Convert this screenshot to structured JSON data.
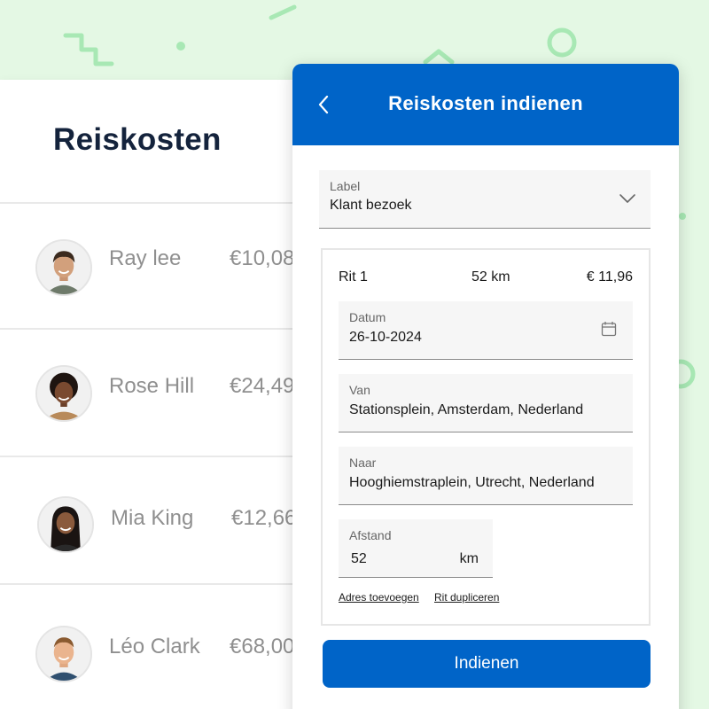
{
  "list": {
    "title": "Reiskosten",
    "people": [
      {
        "name": "Ray lee",
        "amount": "€10,08",
        "avatar_icon": "avatar-man-curly-hair"
      },
      {
        "name": "Rose Hill",
        "amount": "€24,49",
        "avatar_icon": "avatar-woman-curly-hair"
      },
      {
        "name": "Mia King",
        "amount": "€12,66",
        "avatar_icon": "avatar-woman-long-hair"
      },
      {
        "name": "Léo Clark",
        "amount": "€68,00",
        "avatar_icon": "avatar-man-short-hair"
      }
    ]
  },
  "panel": {
    "title": "Reiskosten indienen",
    "back_icon": "chevron-left-icon",
    "label_field": {
      "label": "Label",
      "value": "Klant bezoek",
      "icon": "chevron-down-icon"
    },
    "rit": {
      "name": "Rit 1",
      "distance": "52 km",
      "amount": "€ 11,96",
      "datum": {
        "label": "Datum",
        "value": "26-10-2024",
        "icon": "calendar-icon"
      },
      "van": {
        "label": "Van",
        "value": "Stationsplein, Amsterdam, Nederland"
      },
      "naar": {
        "label": "Naar",
        "value": "Hooghiemstraplein, Utrecht, Nederland"
      },
      "afstand": {
        "label": "Afstand",
        "value": "52",
        "unit": "km"
      }
    },
    "links": {
      "add_address": "Adres toevoegen",
      "duplicate": "Rit dupliceren"
    },
    "submit_label": "Indienen"
  },
  "colors": {
    "primary": "#0064c8",
    "background": "#e4f8e4",
    "decor": "#a8e8b4",
    "title_text": "#14233c",
    "muted_text": "#8f8f8f"
  }
}
